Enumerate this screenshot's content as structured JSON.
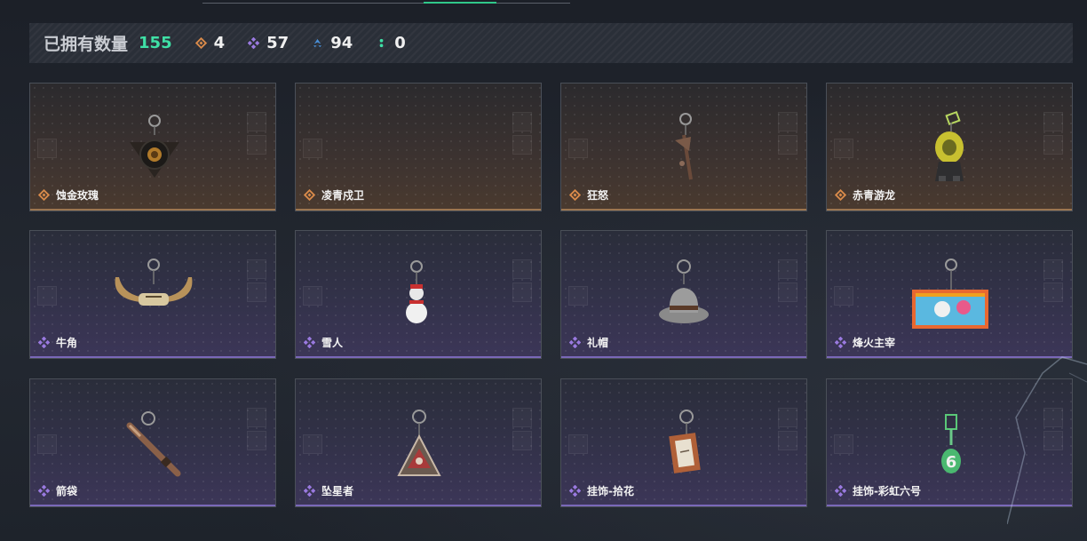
{
  "summary": {
    "owned_label": "已拥有数量",
    "owned_count": "155",
    "stats": [
      {
        "icon": "gold-diamond-icon",
        "value": "4",
        "color": "#d98a4a"
      },
      {
        "icon": "purple-cluster-icon",
        "value": "57",
        "color": "#9a7ae0"
      },
      {
        "icon": "blue-chevron-icon",
        "value": "94",
        "color": "#4a90d9"
      },
      {
        "icon": "green-dots-icon",
        "value": "0",
        "color": "#3fe0a6"
      }
    ]
  },
  "items": [
    {
      "name": "蚀金玫瑰",
      "rarity": "gold",
      "art": "rose-charm"
    },
    {
      "name": "凌青戍卫",
      "rarity": "gold",
      "art": "empty"
    },
    {
      "name": "狂怒",
      "rarity": "gold",
      "art": "axe-charm"
    },
    {
      "name": "赤青游龙",
      "rarity": "gold",
      "art": "dragon-charm"
    },
    {
      "name": "牛角",
      "rarity": "purple",
      "art": "horns-charm"
    },
    {
      "name": "雪人",
      "rarity": "purple",
      "art": "snowman-charm"
    },
    {
      "name": "礼帽",
      "rarity": "purple",
      "art": "hat-charm"
    },
    {
      "name": "烽火主宰",
      "rarity": "purple",
      "art": "graffiti-charm"
    },
    {
      "name": "箭袋",
      "rarity": "purple",
      "art": "quiver-charm"
    },
    {
      "name": "坠星者",
      "rarity": "purple",
      "art": "triangle-charm"
    },
    {
      "name": "挂饰-拾花",
      "rarity": "purple",
      "art": "frame-charm"
    },
    {
      "name": "挂饰-彩虹六号",
      "rarity": "purple",
      "art": "six-charm"
    }
  ],
  "colors": {
    "gold_rarity": "#d98a4a",
    "purple_rarity": "#9a7ae0",
    "accent_green": "#3fe0a6"
  }
}
